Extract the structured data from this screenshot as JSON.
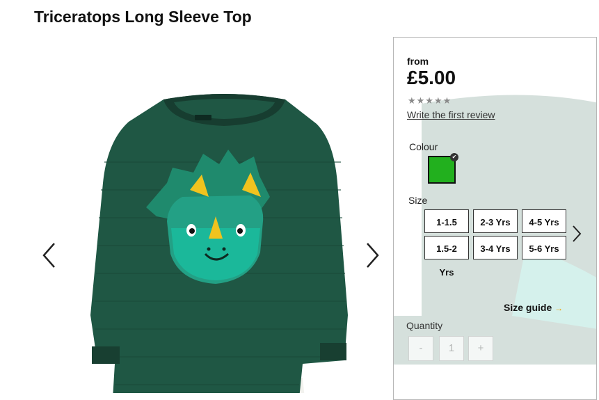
{
  "product": {
    "title": "Triceratops Long Sleeve Top"
  },
  "gallery": {
    "prev_icon": "chevron-left-icon",
    "next_icon": "chevron-right-icon"
  },
  "pricing": {
    "from_label": "from",
    "price": "£5.00"
  },
  "rating": {
    "stars": "★★★★★",
    "review_link": "Write the first review"
  },
  "colour": {
    "label": "Colour",
    "selected_hex": "#22b01e"
  },
  "size": {
    "label": "Size",
    "options": [
      "1-1.5 Yrs",
      "2-3 Yrs",
      "4-5 Yrs",
      "1.5-2 Yrs",
      "3-4 Yrs",
      "5-6 Yrs"
    ]
  },
  "size_guide": {
    "label": "Size guide",
    "arrow": "→"
  },
  "quantity": {
    "label": "Quantity",
    "minus": "-",
    "value": "1",
    "plus": "+"
  }
}
